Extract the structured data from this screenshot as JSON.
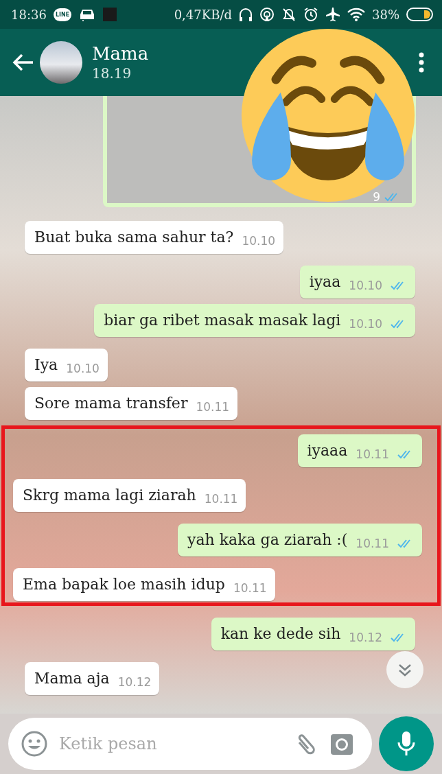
{
  "status_bar": {
    "time": "18:36",
    "line_badge": "LINE",
    "data_rate": "0,47KB/d",
    "battery": "38%"
  },
  "header": {
    "contact_name": "Mama",
    "last_seen": "18.19"
  },
  "image_message": {
    "time": "9",
    "read": true
  },
  "messages": [
    {
      "kind": "message",
      "outgoing": false,
      "text": "Buat buka sama sahur ta?",
      "time": "10.10"
    },
    {
      "kind": "message",
      "outgoing": true,
      "text": "iyaa",
      "time": "10.10",
      "read": true
    },
    {
      "kind": "message",
      "outgoing": true,
      "text": "biar ga ribet masak masak lagi",
      "time": "10.10",
      "read": true
    },
    {
      "kind": "message",
      "outgoing": false,
      "text": "Iya",
      "time": "10.10"
    },
    {
      "kind": "message",
      "outgoing": false,
      "text": "Sore mama transfer",
      "time": "10.11"
    },
    {
      "kind": "highlight",
      "messages": [
        {
          "kind": "message",
          "outgoing": true,
          "text": "iyaaa",
          "time": "10.11",
          "read": true
        },
        {
          "kind": "message",
          "outgoing": false,
          "text": "Skrg mama lagi ziarah",
          "time": "10.11"
        },
        {
          "kind": "message",
          "outgoing": true,
          "text": "yah kaka ga ziarah :(",
          "time": "10.11",
          "read": true
        },
        {
          "kind": "message",
          "outgoing": false,
          "text": "Ema bapak loe masih idup",
          "time": "10.11"
        }
      ]
    },
    {
      "kind": "message",
      "outgoing": true,
      "text": "kan ke dede sih",
      "time": "10.12",
      "read": true
    },
    {
      "kind": "message",
      "outgoing": false,
      "text": "Mama aja",
      "time": "10.12"
    }
  ],
  "composer": {
    "placeholder": "Ketik pesan"
  }
}
